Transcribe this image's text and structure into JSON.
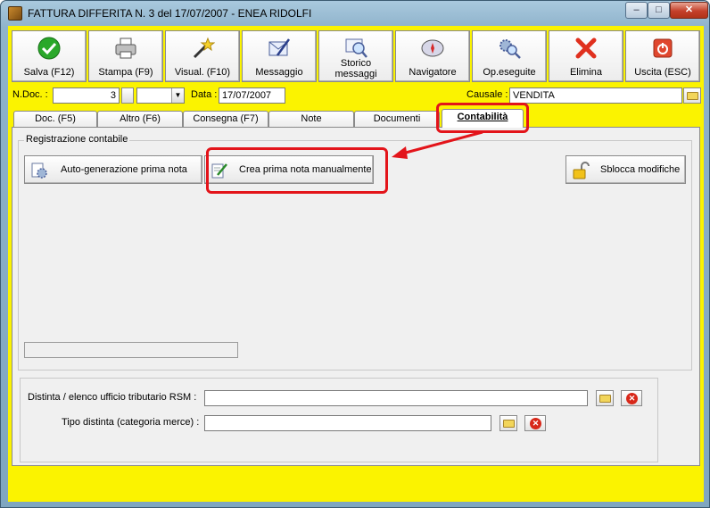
{
  "window": {
    "title": "FATTURA DIFFERITA N. 3  del 17/07/2007 - ENEA RIDOLFI"
  },
  "toolbar": [
    {
      "label": "Salva (F12)",
      "icon": "check-icon"
    },
    {
      "label": "Stampa (F9)",
      "icon": "printer-icon"
    },
    {
      "label": "Visual. (F10)",
      "icon": "magic-wand-icon"
    },
    {
      "label": "Messaggio",
      "icon": "message-pen-icon"
    },
    {
      "label": "Storico\nmessaggi",
      "icon": "search-history-icon"
    },
    {
      "label": "Navigatore",
      "icon": "compass-icon"
    },
    {
      "label": "Op.eseguite",
      "icon": "gears-search-icon"
    },
    {
      "label": "Elimina",
      "icon": "red-x-icon"
    },
    {
      "label": "Uscita (ESC)",
      "icon": "exit-power-icon"
    }
  ],
  "doc": {
    "ndoc_label": "N.Doc. :",
    "ndoc_value": "3",
    "series_value": "",
    "data_label": "Data :",
    "data_value": "17/07/2007",
    "causale_label": "Causale :",
    "causale_value": "VENDITA"
  },
  "tabs": [
    {
      "label": "Doc. (F5)"
    },
    {
      "label": "Altro (F6)"
    },
    {
      "label": "Consegna (F7)"
    },
    {
      "label": "Note"
    },
    {
      "label": "Documenti"
    },
    {
      "label": "Contabilità",
      "active": true
    }
  ],
  "contabilita": {
    "group_title": "Registrazione contabile",
    "auto_button": "Auto-generazione prima nota",
    "manual_button": "Crea prima nota manualmente",
    "unlock_button": "Sblocca modifiche"
  },
  "bottom": {
    "distinta_label": "Distinta / elenco ufficio tributario RSM :",
    "distinta_value": "",
    "tipo_label": "Tipo distinta (categoria merce) :",
    "tipo_value": ""
  },
  "colors": {
    "form_bg": "#fbf300",
    "panel_bg": "#f0f0f0",
    "highlight": "#e3141a"
  }
}
